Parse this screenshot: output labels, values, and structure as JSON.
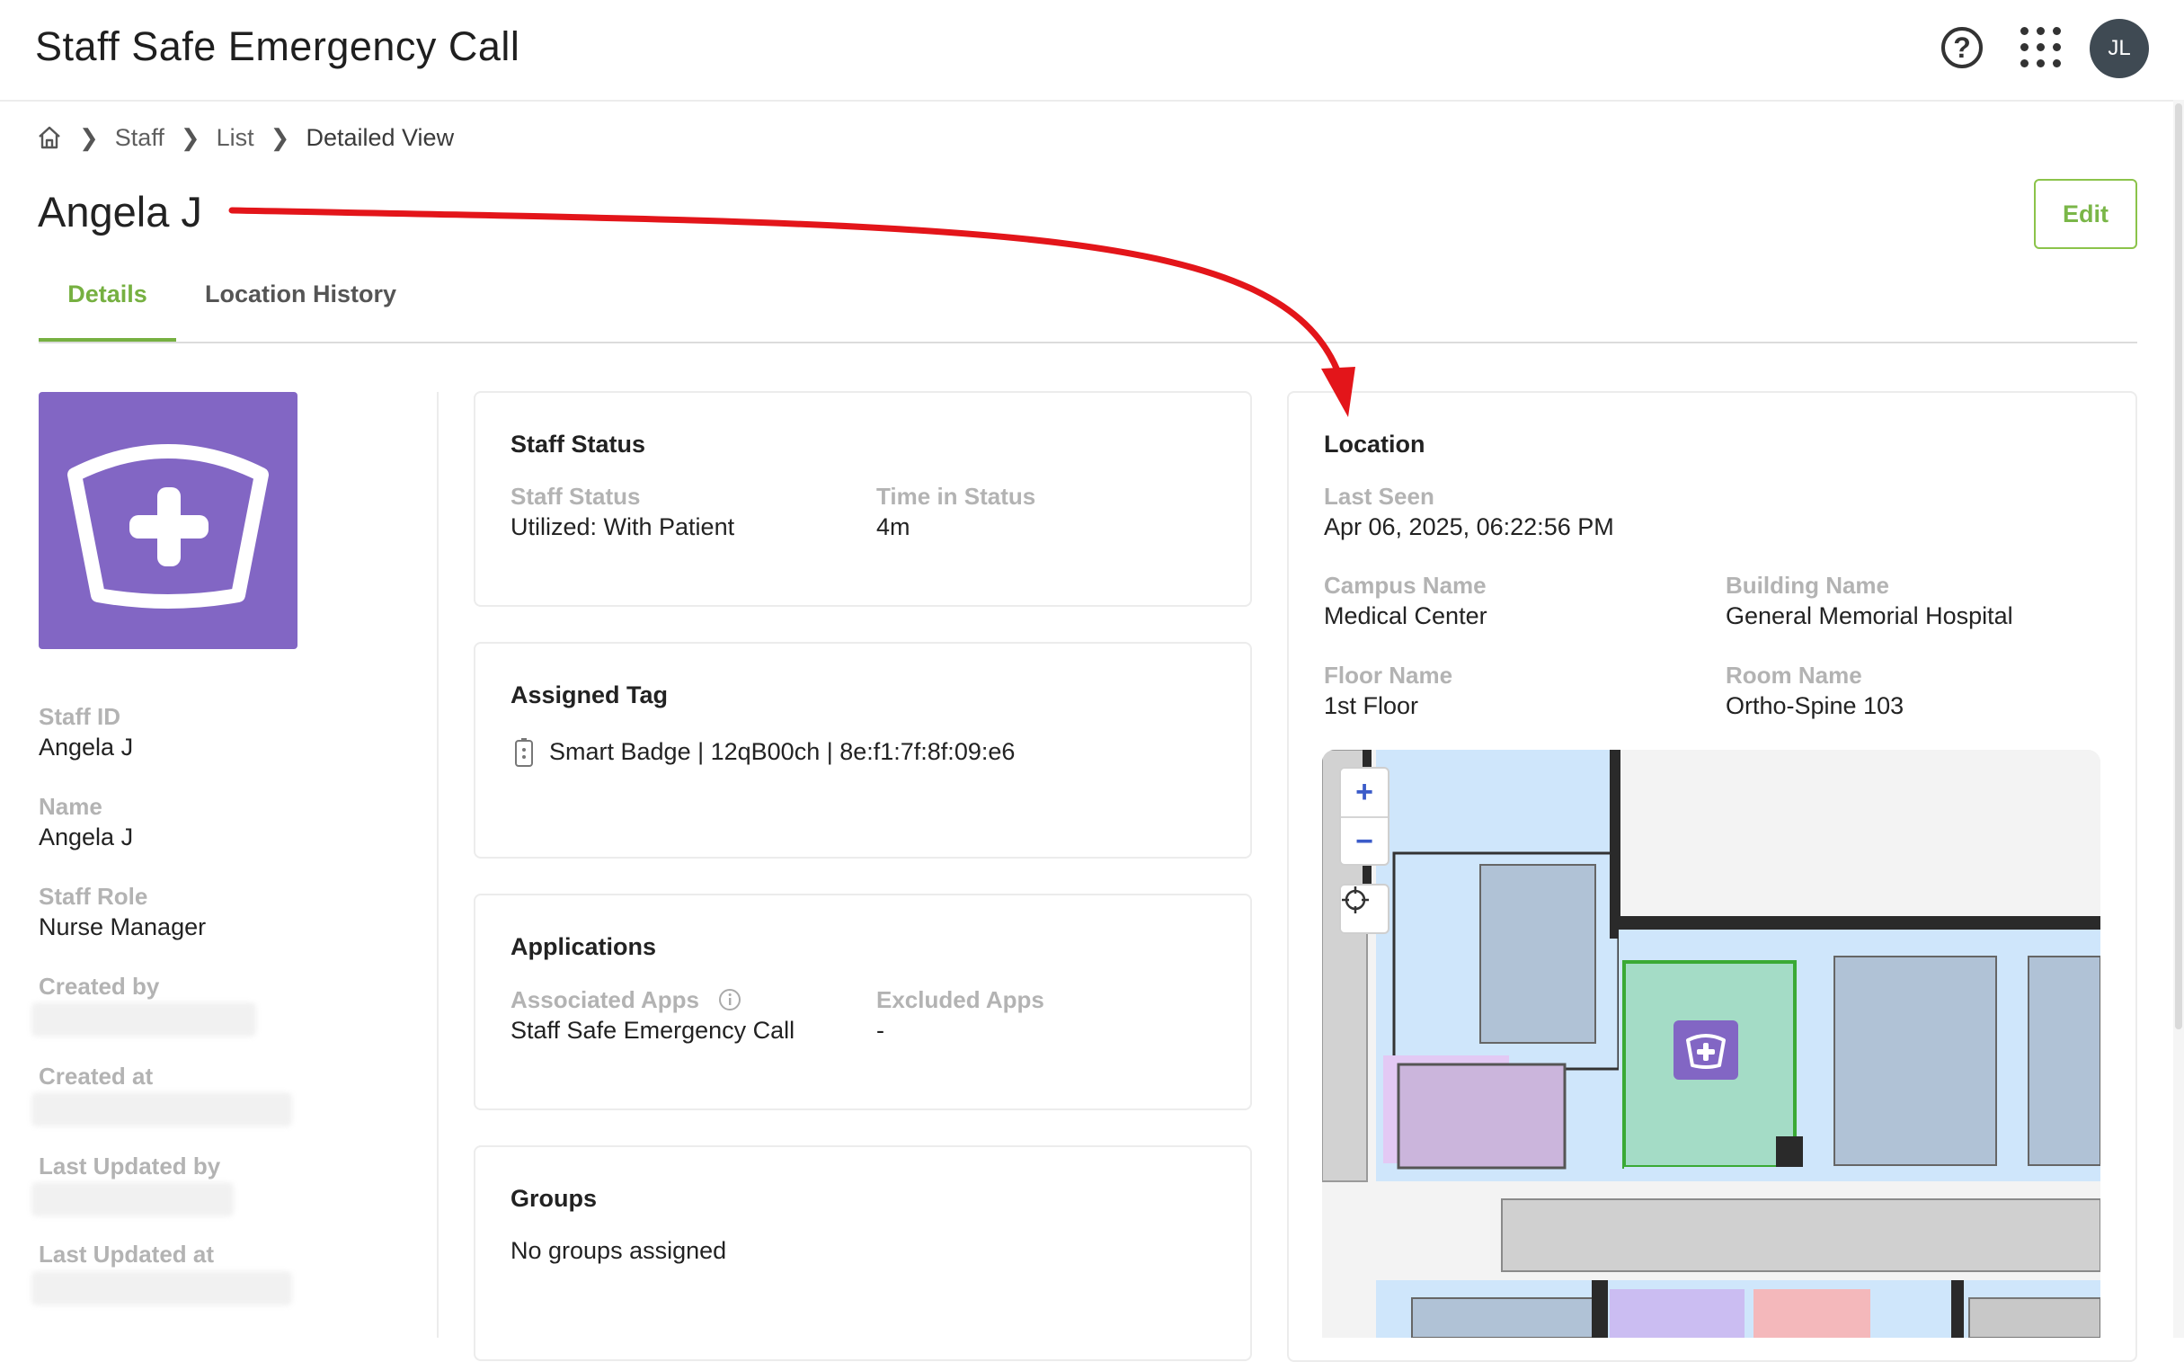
{
  "header": {
    "app_title": "Staff Safe Emergency Call",
    "help_icon": "?",
    "avatar_initials": "JL"
  },
  "breadcrumb": {
    "items": [
      "Staff",
      "List"
    ],
    "current": "Detailed View"
  },
  "person": {
    "name": "Angela J",
    "edit_label": "Edit"
  },
  "tabs": [
    {
      "label": "Details",
      "active": true
    },
    {
      "label": "Location History",
      "active": false
    }
  ],
  "profile": {
    "fields": [
      {
        "label": "Staff ID",
        "value": "Angela J"
      },
      {
        "label": "Name",
        "value": "Angela J"
      },
      {
        "label": "Staff Role",
        "value": "Nurse Manager"
      },
      {
        "label": "Created by",
        "value": ""
      },
      {
        "label": "Created at",
        "value": ""
      },
      {
        "label": "Last Updated by",
        "value": ""
      },
      {
        "label": "Last Updated at",
        "value": ""
      }
    ]
  },
  "staff_status": {
    "title": "Staff Status",
    "status_label": "Staff Status",
    "status_value": "Utilized: With Patient",
    "time_label": "Time in Status",
    "time_value": "4m"
  },
  "assigned_tag": {
    "title": "Assigned Tag",
    "tag_text": "Smart Badge | 12qB00ch | 8e:f1:7f:8f:09:e6"
  },
  "applications": {
    "title": "Applications",
    "associated_label": "Associated Apps",
    "associated_value": "Staff Safe Emergency Call",
    "excluded_label": "Excluded Apps",
    "excluded_value": "-"
  },
  "groups": {
    "title": "Groups",
    "value": "No groups assigned"
  },
  "location": {
    "title": "Location",
    "last_seen_label": "Last Seen",
    "last_seen_value": "Apr 06, 2025, 06:22:56 PM",
    "campus_label": "Campus Name",
    "campus_value": "Medical Center",
    "building_label": "Building Name",
    "building_value": "General Memorial Hospital",
    "floor_label": "Floor Name",
    "floor_value": "1st Floor",
    "room_label": "Room Name",
    "room_value": "Ortho-Spine 103"
  },
  "map": {
    "zoom_in": "+",
    "zoom_out": "−"
  },
  "colors": {
    "accent_green": "#76b041",
    "staff_purple": "#8266c4",
    "annotation_red": "#e3151a",
    "highlight_room": "#3aaa35"
  }
}
